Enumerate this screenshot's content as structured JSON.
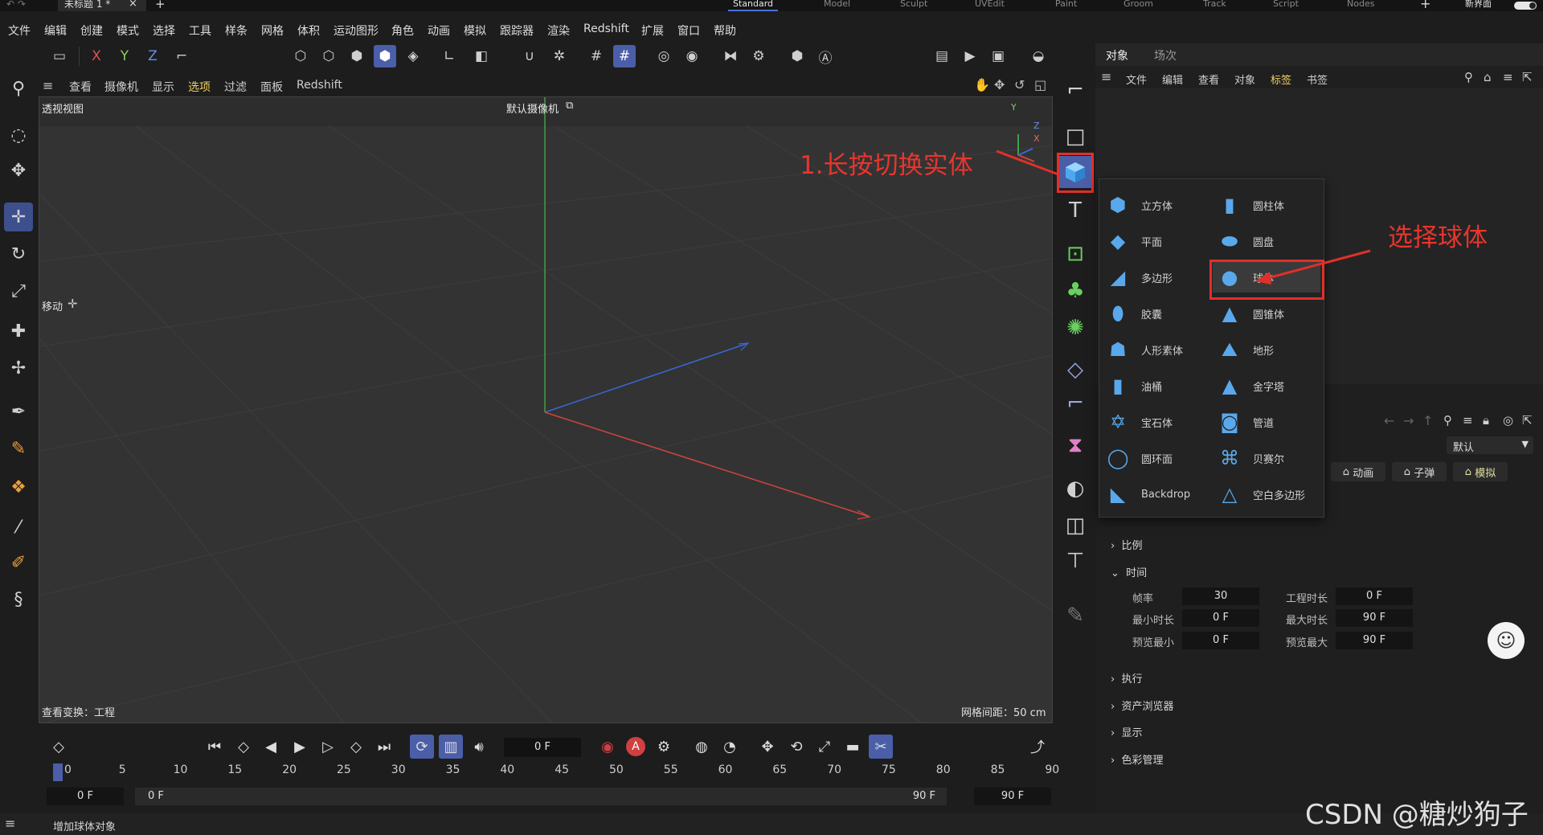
{
  "titlebar": {
    "doc_tab": "未标题 1 *",
    "close": "×",
    "add": "+",
    "layout_tabs": [
      "Standard",
      "Model",
      "Sculpt",
      "UVEdit",
      "Paint",
      "Groom",
      "Track",
      "Script",
      "Nodes"
    ],
    "active_layout": "Standard",
    "new_ui_label": "新界面"
  },
  "menu": [
    "文件",
    "编辑",
    "创建",
    "模式",
    "选择",
    "工具",
    "样条",
    "网格",
    "体积",
    "运动图形",
    "角色",
    "动画",
    "模拟",
    "跟踪器",
    "渲染",
    "Redshift",
    "扩展",
    "窗口",
    "帮助"
  ],
  "toolbar": {
    "axis_x": "X",
    "axis_y": "Y",
    "axis_z": "Z"
  },
  "viewport": {
    "menu": [
      "查看",
      "摄像机",
      "显示",
      "选项",
      "过滤",
      "面板",
      "Redshift"
    ],
    "active_menu": "选项",
    "view_name": "透视视图",
    "camera": "默认摄像机",
    "move_label": "移动",
    "bottom_left": "查看变换：工程",
    "bottom_right": "网格间距：50 cm",
    "axis_y": "Y",
    "axis_z": "Z",
    "axis_x": "X"
  },
  "object_manager": {
    "tabs": [
      "对象",
      "场次"
    ],
    "menu": [
      "文件",
      "编辑",
      "查看",
      "对象",
      "标签",
      "书签"
    ]
  },
  "primitives_popup": {
    "items": [
      {
        "label": "立方体",
        "icon": "cube-icon"
      },
      {
        "label": "圆柱体",
        "icon": "cylinder-icon"
      },
      {
        "label": "平面",
        "icon": "plane-icon"
      },
      {
        "label": "圆盘",
        "icon": "disc-icon"
      },
      {
        "label": "多边形",
        "icon": "polygon-icon"
      },
      {
        "label": "球体",
        "icon": "sphere-icon"
      },
      {
        "label": "胶囊",
        "icon": "capsule-icon"
      },
      {
        "label": "圆锥体",
        "icon": "cone-icon"
      },
      {
        "label": "人形素体",
        "icon": "figure-icon"
      },
      {
        "label": "地形",
        "icon": "landscape-icon"
      },
      {
        "label": "油桶",
        "icon": "oil-tank-icon"
      },
      {
        "label": "金字塔",
        "icon": "pyramid-icon"
      },
      {
        "label": "宝石体",
        "icon": "platonic-icon"
      },
      {
        "label": "管道",
        "icon": "tube-icon"
      },
      {
        "label": "圆环面",
        "icon": "torus-icon"
      },
      {
        "label": "贝赛尔",
        "icon": "bezier-icon"
      },
      {
        "label": "Backdrop",
        "icon": "backdrop-icon"
      },
      {
        "label": "空白多边形",
        "icon": "empty-polygon-icon"
      }
    ],
    "selected": "球体"
  },
  "annotations": {
    "step1": "1.长按切换实体",
    "step2": "选择球体"
  },
  "attributes": {
    "mode_dropdown": "默认",
    "mode_buttons": [
      "动画",
      "子弹",
      "模拟"
    ],
    "sections": {
      "scale": "比例",
      "time": "时间",
      "execute": "执行",
      "asset_browser": "资产浏览器",
      "display": "显示",
      "color_mgmt": "色彩管理"
    },
    "fields": [
      {
        "label": "帧率",
        "value": "30"
      },
      {
        "label": "工程时长",
        "value": "0 F"
      },
      {
        "label": "最小时长",
        "value": "0 F"
      },
      {
        "label": "最大时长",
        "value": "90 F"
      },
      {
        "label": "预览最小",
        "value": "0 F"
      },
      {
        "label": "预览最大",
        "value": "90 F"
      }
    ]
  },
  "timeline": {
    "current_frame": "0 F",
    "ticks": [
      "0",
      "5",
      "10",
      "15",
      "20",
      "25",
      "30",
      "35",
      "40",
      "45",
      "50",
      "55",
      "60",
      "65",
      "70",
      "75",
      "80",
      "85",
      "90"
    ],
    "range_start_a": "0 F",
    "range_start_b": "0 F",
    "range_end_a": "90 F",
    "range_end_b": "90 F"
  },
  "status": {
    "message": "增加球体对象"
  },
  "watermark": "CSDN @糖炒狗子",
  "colors": {
    "accent": "#4b5ea8",
    "annotation": "#e0302a",
    "y_axis": "#3fa04a",
    "x_axis": "#d0453f",
    "z_axis": "#3868d8"
  }
}
